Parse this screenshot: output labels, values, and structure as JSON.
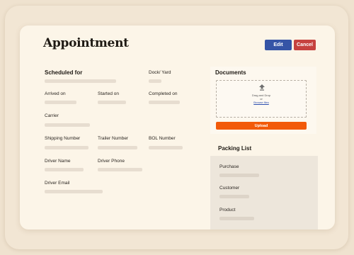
{
  "page": {
    "title": "Appointment"
  },
  "toolbar": {
    "edit_label": "Edit",
    "cancel_label": "Cancel",
    "colors": {
      "edit": "#3554a6",
      "cancel": "#c6423f"
    }
  },
  "details": {
    "scheduled_for": "Scheduled for",
    "dock_yard": "Dock/ Yard",
    "arrived_on": "Arrived on",
    "started_on": "Started on",
    "completed_on": "Completed on",
    "carrier": "Carrier",
    "shipping_number": "Shipping Number",
    "trailer_number": "Trailer Number",
    "bol_number": "BOL Number",
    "driver_name": "Driver Name",
    "driver_phone": "Driver Phone",
    "driver_email": "Driver Email"
  },
  "documents": {
    "heading": "Documents",
    "drag_text": "Drag and Drop",
    "or_text": "or",
    "browse_link": "Browse files",
    "upload_label": "Upload",
    "icon": "upload-icon",
    "upload_color": "#f25a0a"
  },
  "packing_list": {
    "heading": "Packing List",
    "purchase": "Purchase",
    "customer": "Customer",
    "product": "Product"
  }
}
